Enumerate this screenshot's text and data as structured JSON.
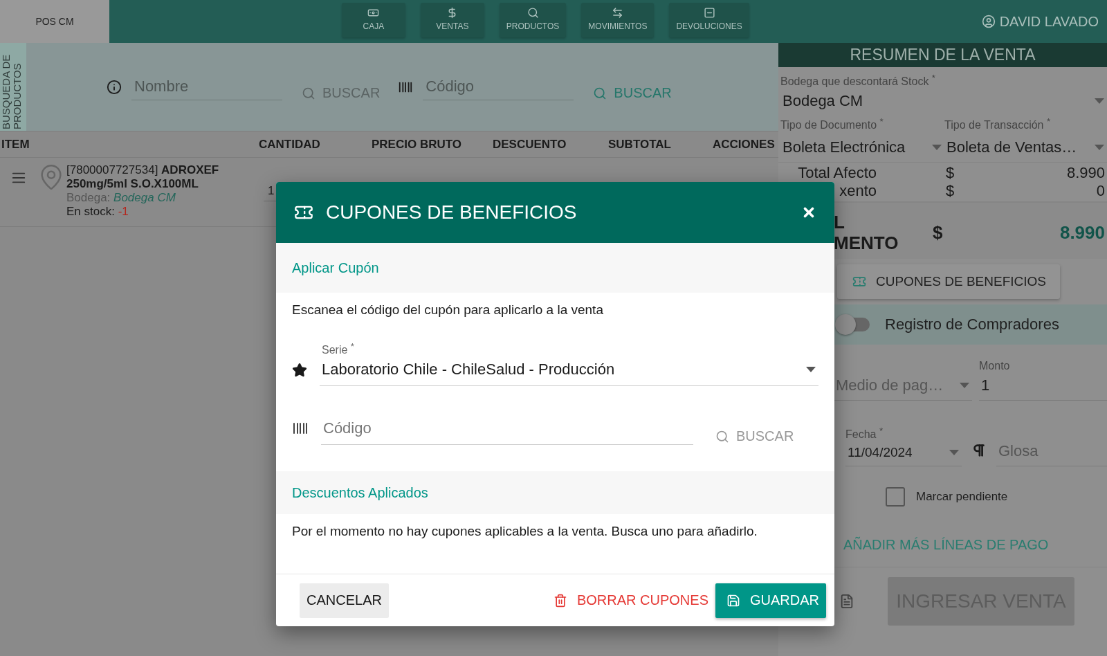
{
  "app": {
    "title": "POS CM",
    "user": "DAVID LAVADO"
  },
  "nav": [
    {
      "kind": "cash",
      "label": "CAJA"
    },
    {
      "kind": "sales",
      "label": "VENTAS"
    },
    {
      "kind": "products",
      "label": "PRODUCTOS"
    },
    {
      "kind": "movements",
      "label": "MOVIMIENTOS"
    },
    {
      "kind": "returns",
      "label": "DEVOLUCIONES"
    }
  ],
  "search": {
    "section_label": "BUSQUEDA DE PRODUCTOS",
    "fields": [
      {
        "kind": "name",
        "placeholder": "Nombre",
        "button": "BUSCAR",
        "disabled": true
      },
      {
        "kind": "code",
        "placeholder": "Código",
        "button": "BUSCAR",
        "disabled": false
      }
    ]
  },
  "table": {
    "columns": [
      "ITEM",
      "CANTIDAD",
      "PRECIO BRUTO",
      "DESCUENTO",
      "SUBTOTAL",
      "ACCIONES"
    ],
    "rows": [
      {
        "name": "[7800007727534] **ADROXEF 250mg/5ml S.O.X100ML**",
        "warehouse_label": "Bodega:",
        "warehouse": "Bodega CM",
        "stock_label": "En stock:",
        "stock": "-1",
        "quantity": "1"
      }
    ]
  },
  "summary": {
    "title": "RESUMEN DE LA VENTA",
    "warehouse": {
      "label": "Bodega que descontará Stock $^{*}$",
      "value": "Bodega CM"
    },
    "document_type": {
      "label": "Tipo de Documento $^{*}$",
      "value": "Boleta Electrónica"
    },
    "transaction_type": {
      "label": "Tipo de Transacción $^{*}$",
      "value": "Boleta de Ventas…"
    },
    "totals": [
      {
        "label": "Total Afecto",
        "currency": "$",
        "value": "8.990"
      },
      {
        "label": "xento",
        "currency": "$",
        "value": "0"
      }
    ],
    "grand_total": {
      "label_lines": [
        "L",
        "MENTO"
      ],
      "currency": "$",
      "value": "8.990"
    },
    "coupon_button": "CUPONES DE BENEFICIOS",
    "buyers_toggle": {
      "label": "Registro de Compradores",
      "on": false
    },
    "payment": {
      "method_placeholder": "Medio de pag…",
      "amount_label": "Monto",
      "amount": "1"
    },
    "date": {
      "label": "Fecha $^{*}$",
      "value": "11/04/2024"
    },
    "note_placeholder": "Glosa",
    "pending": {
      "label": "Marcar pendiente",
      "checked": false
    },
    "add_lines": "AÑADIR MÁS LÍNEAS DE PAGO",
    "submit": {
      "label": "INGRESAR VENTA",
      "disabled": true
    }
  },
  "modal": {
    "title": "CUPONES DE BENEFICIOS",
    "apply_heading": "Aplicar Cupón",
    "instructions": "Escanea el código del cupón para aplicarlo a la venta",
    "series": {
      "label": "Serie $^{*}$",
      "value": "Laboratorio Chile - ChileSalud - Producción"
    },
    "code": {
      "placeholder": "Código",
      "button": "BUSCAR",
      "disabled": true
    },
    "applied_heading": "Descuentos Aplicados",
    "empty_message": "Por el momento no hay cupones aplicables a la venta. Busca uno para añadirlo.",
    "cancel": "CANCELAR",
    "clear": "BORRAR CUPONES",
    "save": "GUARDAR"
  }
}
